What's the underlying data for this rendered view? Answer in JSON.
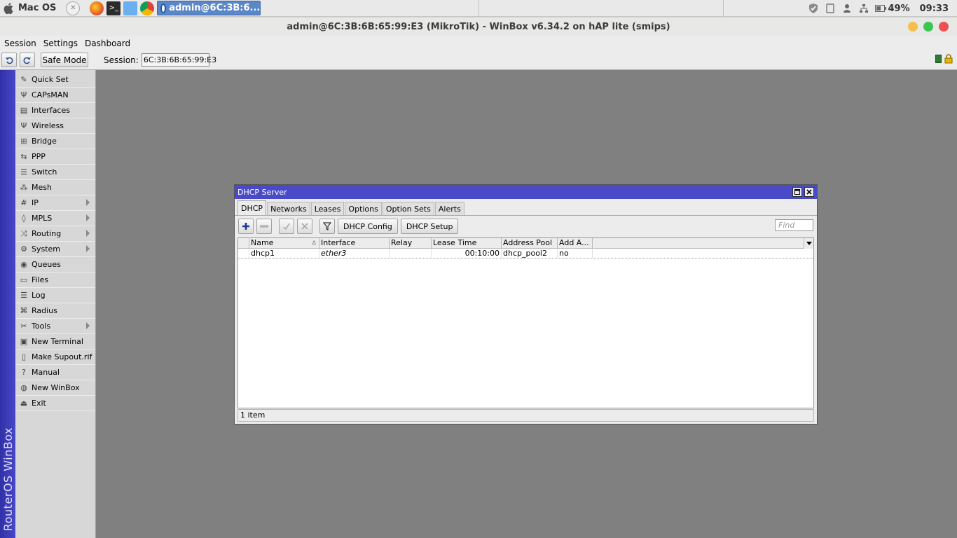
{
  "taskbar": {
    "os_label": "Mac OS",
    "task_button": "admin@6C:3B:6...",
    "battery": "49%",
    "clock": "09:33"
  },
  "app": {
    "title": "admin@6C:3B:6B:65:99:E3 (MikroTik) - WinBox v6.34.2 on hAP lite (smips)"
  },
  "menubar": [
    "Session",
    "Settings",
    "Dashboard"
  ],
  "toolbar": {
    "safe_mode": "Safe Mode",
    "session_label": "Session:",
    "session_value": "6C:3B:6B:65:99:E3"
  },
  "sidebar": {
    "brand": "RouterOS WinBox",
    "items": [
      {
        "label": "Quick Set",
        "icon": "wand-icon",
        "submenu": false
      },
      {
        "label": "CAPsMAN",
        "icon": "antenna-icon",
        "submenu": false
      },
      {
        "label": "Interfaces",
        "icon": "interfaces-icon",
        "submenu": false
      },
      {
        "label": "Wireless",
        "icon": "wireless-icon",
        "submenu": false
      },
      {
        "label": "Bridge",
        "icon": "bridge-icon",
        "submenu": false
      },
      {
        "label": "PPP",
        "icon": "ppp-icon",
        "submenu": false
      },
      {
        "label": "Switch",
        "icon": "switch-icon",
        "submenu": false
      },
      {
        "label": "Mesh",
        "icon": "mesh-icon",
        "submenu": false
      },
      {
        "label": "IP",
        "icon": "ip-icon",
        "submenu": true
      },
      {
        "label": "MPLS",
        "icon": "mpls-icon",
        "submenu": true
      },
      {
        "label": "Routing",
        "icon": "routing-icon",
        "submenu": true
      },
      {
        "label": "System",
        "icon": "gear-icon",
        "submenu": true
      },
      {
        "label": "Queues",
        "icon": "queues-icon",
        "submenu": false
      },
      {
        "label": "Files",
        "icon": "folder-icon",
        "submenu": false
      },
      {
        "label": "Log",
        "icon": "log-icon",
        "submenu": false
      },
      {
        "label": "Radius",
        "icon": "radius-icon",
        "submenu": false
      },
      {
        "label": "Tools",
        "icon": "tools-icon",
        "submenu": true
      },
      {
        "label": "New Terminal",
        "icon": "terminal-icon",
        "submenu": false
      },
      {
        "label": "Make Supout.rif",
        "icon": "document-icon",
        "submenu": false
      },
      {
        "label": "Manual",
        "icon": "help-icon",
        "submenu": false
      },
      {
        "label": "New WinBox",
        "icon": "winbox-icon",
        "submenu": false
      },
      {
        "label": "Exit",
        "icon": "exit-icon",
        "submenu": false
      }
    ]
  },
  "dhcp_window": {
    "title": "DHCP Server",
    "tabs": [
      "DHCP",
      "Networks",
      "Leases",
      "Options",
      "Option Sets",
      "Alerts"
    ],
    "active_tab": "DHCP",
    "buttons": {
      "config": "DHCP Config",
      "setup": "DHCP Setup"
    },
    "find_placeholder": "Find",
    "columns": [
      "Name",
      "Interface",
      "Relay",
      "Lease Time",
      "Address Pool",
      "Add A..."
    ],
    "rows": [
      {
        "name": "dhcp1",
        "interface": "ether3",
        "relay": "",
        "lease_time": "00:10:00",
        "address_pool": "dhcp_pool2",
        "add_arp": "no"
      }
    ],
    "status": "1 item"
  },
  "colors": {
    "window_title": "#4a4ac8",
    "brand_strip": "#3a3ab8",
    "desktop": "#808080"
  }
}
